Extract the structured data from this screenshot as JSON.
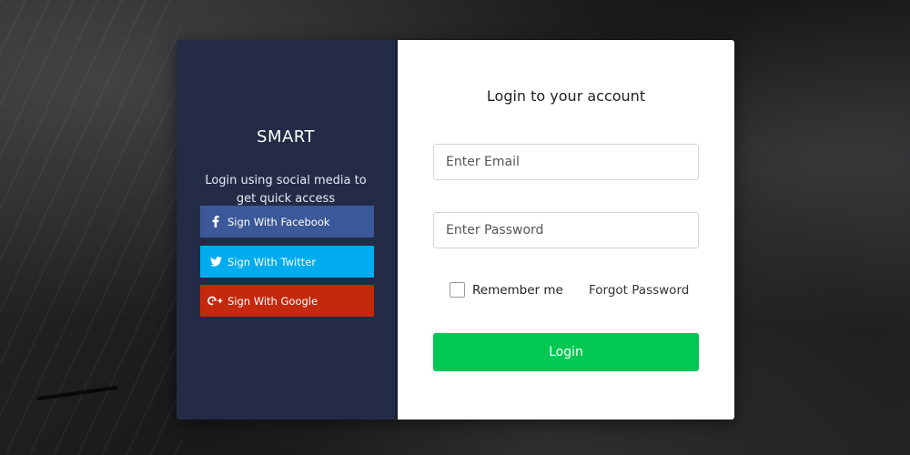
{
  "left_panel": {
    "brand": "SMART",
    "tagline": "Login using social media to get quick access",
    "social_buttons": [
      {
        "label": "Sign With Facebook",
        "icon": "facebook-icon",
        "color": "#3b5998"
      },
      {
        "label": "Sign With Twitter",
        "icon": "twitter-icon",
        "color": "#00acee"
      },
      {
        "label": "Sign With Google",
        "icon": "google-plus-icon",
        "color": "#c4290e"
      }
    ]
  },
  "login_form": {
    "title": "Login to your account",
    "email_placeholder": "Enter Email",
    "password_placeholder": "Enter Password",
    "remember_label": "Remember me",
    "forgot_label": "Forgot Password",
    "submit_label": "Login",
    "submit_color": "#00c853"
  },
  "colors": {
    "left_panel_bg": "#232b47",
    "right_panel_bg": "#ffffff"
  }
}
